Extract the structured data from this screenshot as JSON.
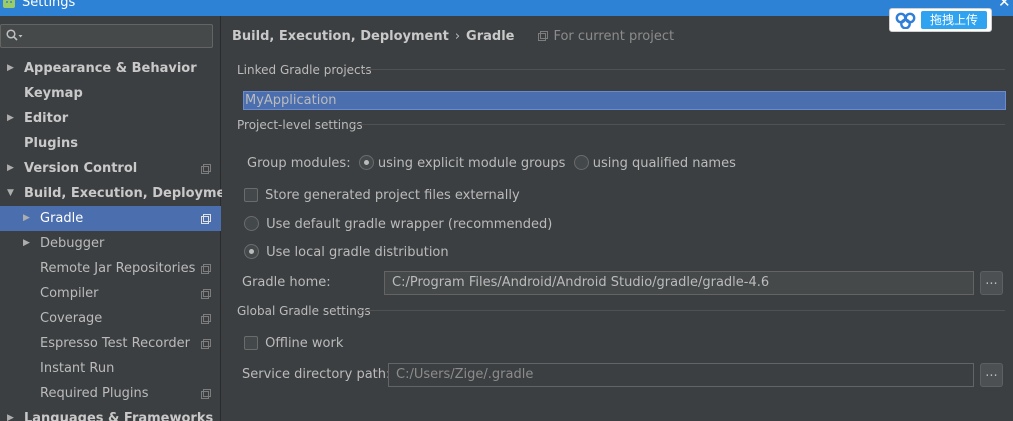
{
  "window": {
    "title": "Settings",
    "close_glyph": "✕"
  },
  "search": {
    "icon": "search-icon"
  },
  "sidebar": {
    "items": [
      {
        "label": "Appearance & Behavior",
        "arrow": "▶"
      },
      {
        "label": "Keymap"
      },
      {
        "label": "Editor",
        "arrow": "▶"
      },
      {
        "label": "Plugins"
      },
      {
        "label": "Version Control",
        "arrow": "▶"
      },
      {
        "label": "Build, Execution, Deployment",
        "arrow": "▼"
      },
      {
        "label": "Gradle",
        "arrow": "▶"
      },
      {
        "label": "Debugger",
        "arrow": "▶"
      },
      {
        "label": "Remote Jar Repositories"
      },
      {
        "label": "Compiler"
      },
      {
        "label": "Coverage"
      },
      {
        "label": "Espresso Test Recorder"
      },
      {
        "label": "Instant Run"
      },
      {
        "label": "Required Plugins"
      },
      {
        "label": "Languages & Frameworks",
        "arrow": "▶"
      }
    ]
  },
  "breadcrumb": {
    "parent": "Build, Execution, Deployment",
    "separator": "›",
    "current": "Gradle",
    "scope": "For current project"
  },
  "linked": {
    "section_title": "Linked Gradle projects",
    "projects": [
      "MyApplication"
    ]
  },
  "project_level": {
    "section_title": "Project-level settings",
    "group_modules_label": "Group modules:",
    "option_explicit": "using explicit module groups",
    "option_qualified": "using qualified names",
    "store_externally": "Store generated project files externally",
    "use_default_wrapper": "Use default gradle wrapper (recommended)",
    "use_local_distribution": "Use local gradle distribution",
    "gradle_home_label": "Gradle home:",
    "gradle_home_value": "C:/Program Files/Android/Android Studio/gradle/gradle-4.6",
    "browse_label": "..."
  },
  "global": {
    "section_title": "Global Gradle settings",
    "offline_work": "Offline work",
    "service_dir_label": "Service directory path:",
    "service_dir_value": "C:/Users/Zige/.gradle",
    "browse_label": "..."
  },
  "upload_widget": {
    "label": "拖拽上传"
  },
  "colors": {
    "selection": "#4b6eaf",
    "background": "#3c3f41",
    "titlebar": "#2e82d6",
    "upload_button": "#2fa3f0"
  }
}
